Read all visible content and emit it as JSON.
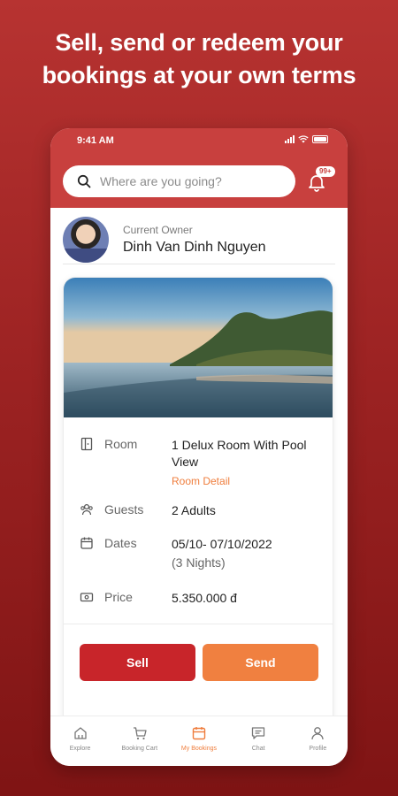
{
  "headline": {
    "line1": "Sell, send or redeem your",
    "line2": "bookings at your own terms"
  },
  "status_bar": {
    "time": "9:41 AM"
  },
  "search": {
    "placeholder": "Where are you going?",
    "icon": "search-icon"
  },
  "notifications": {
    "badge": "99+",
    "icon": "bell-icon"
  },
  "owner": {
    "label": "Current Owner",
    "name": "Dinh Van Dinh Nguyen"
  },
  "booking": {
    "room": {
      "label": "Room",
      "value": "1 Delux Room With Pool View",
      "link": "Room Detail",
      "icon": "door-icon"
    },
    "guests": {
      "label": "Guests",
      "value": "2 Adults",
      "icon": "guests-icon"
    },
    "dates": {
      "label": "Dates",
      "value": "05/10- 07/10/2022",
      "sub": "(3 Nights)",
      "icon": "calendar-icon"
    },
    "price": {
      "label": "Price",
      "value": "5.350.000 đ",
      "icon": "cash-icon"
    }
  },
  "actions": {
    "sell": "Sell",
    "send": "Send"
  },
  "nav": [
    {
      "label": "Explore",
      "icon": "home-icon",
      "active": false
    },
    {
      "label": "Booking Cart",
      "icon": "cart-icon",
      "active": false
    },
    {
      "label": "My Bookings",
      "icon": "calendar-icon",
      "active": true
    },
    {
      "label": "Chat",
      "icon": "chat-icon",
      "active": false
    },
    {
      "label": "Profile",
      "icon": "user-icon",
      "active": false
    }
  ],
  "colors": {
    "brand_red": "#c8403e",
    "sell_red": "#c8252a",
    "accent_orange": "#f08040",
    "link_orange": "#ef7d3c"
  }
}
